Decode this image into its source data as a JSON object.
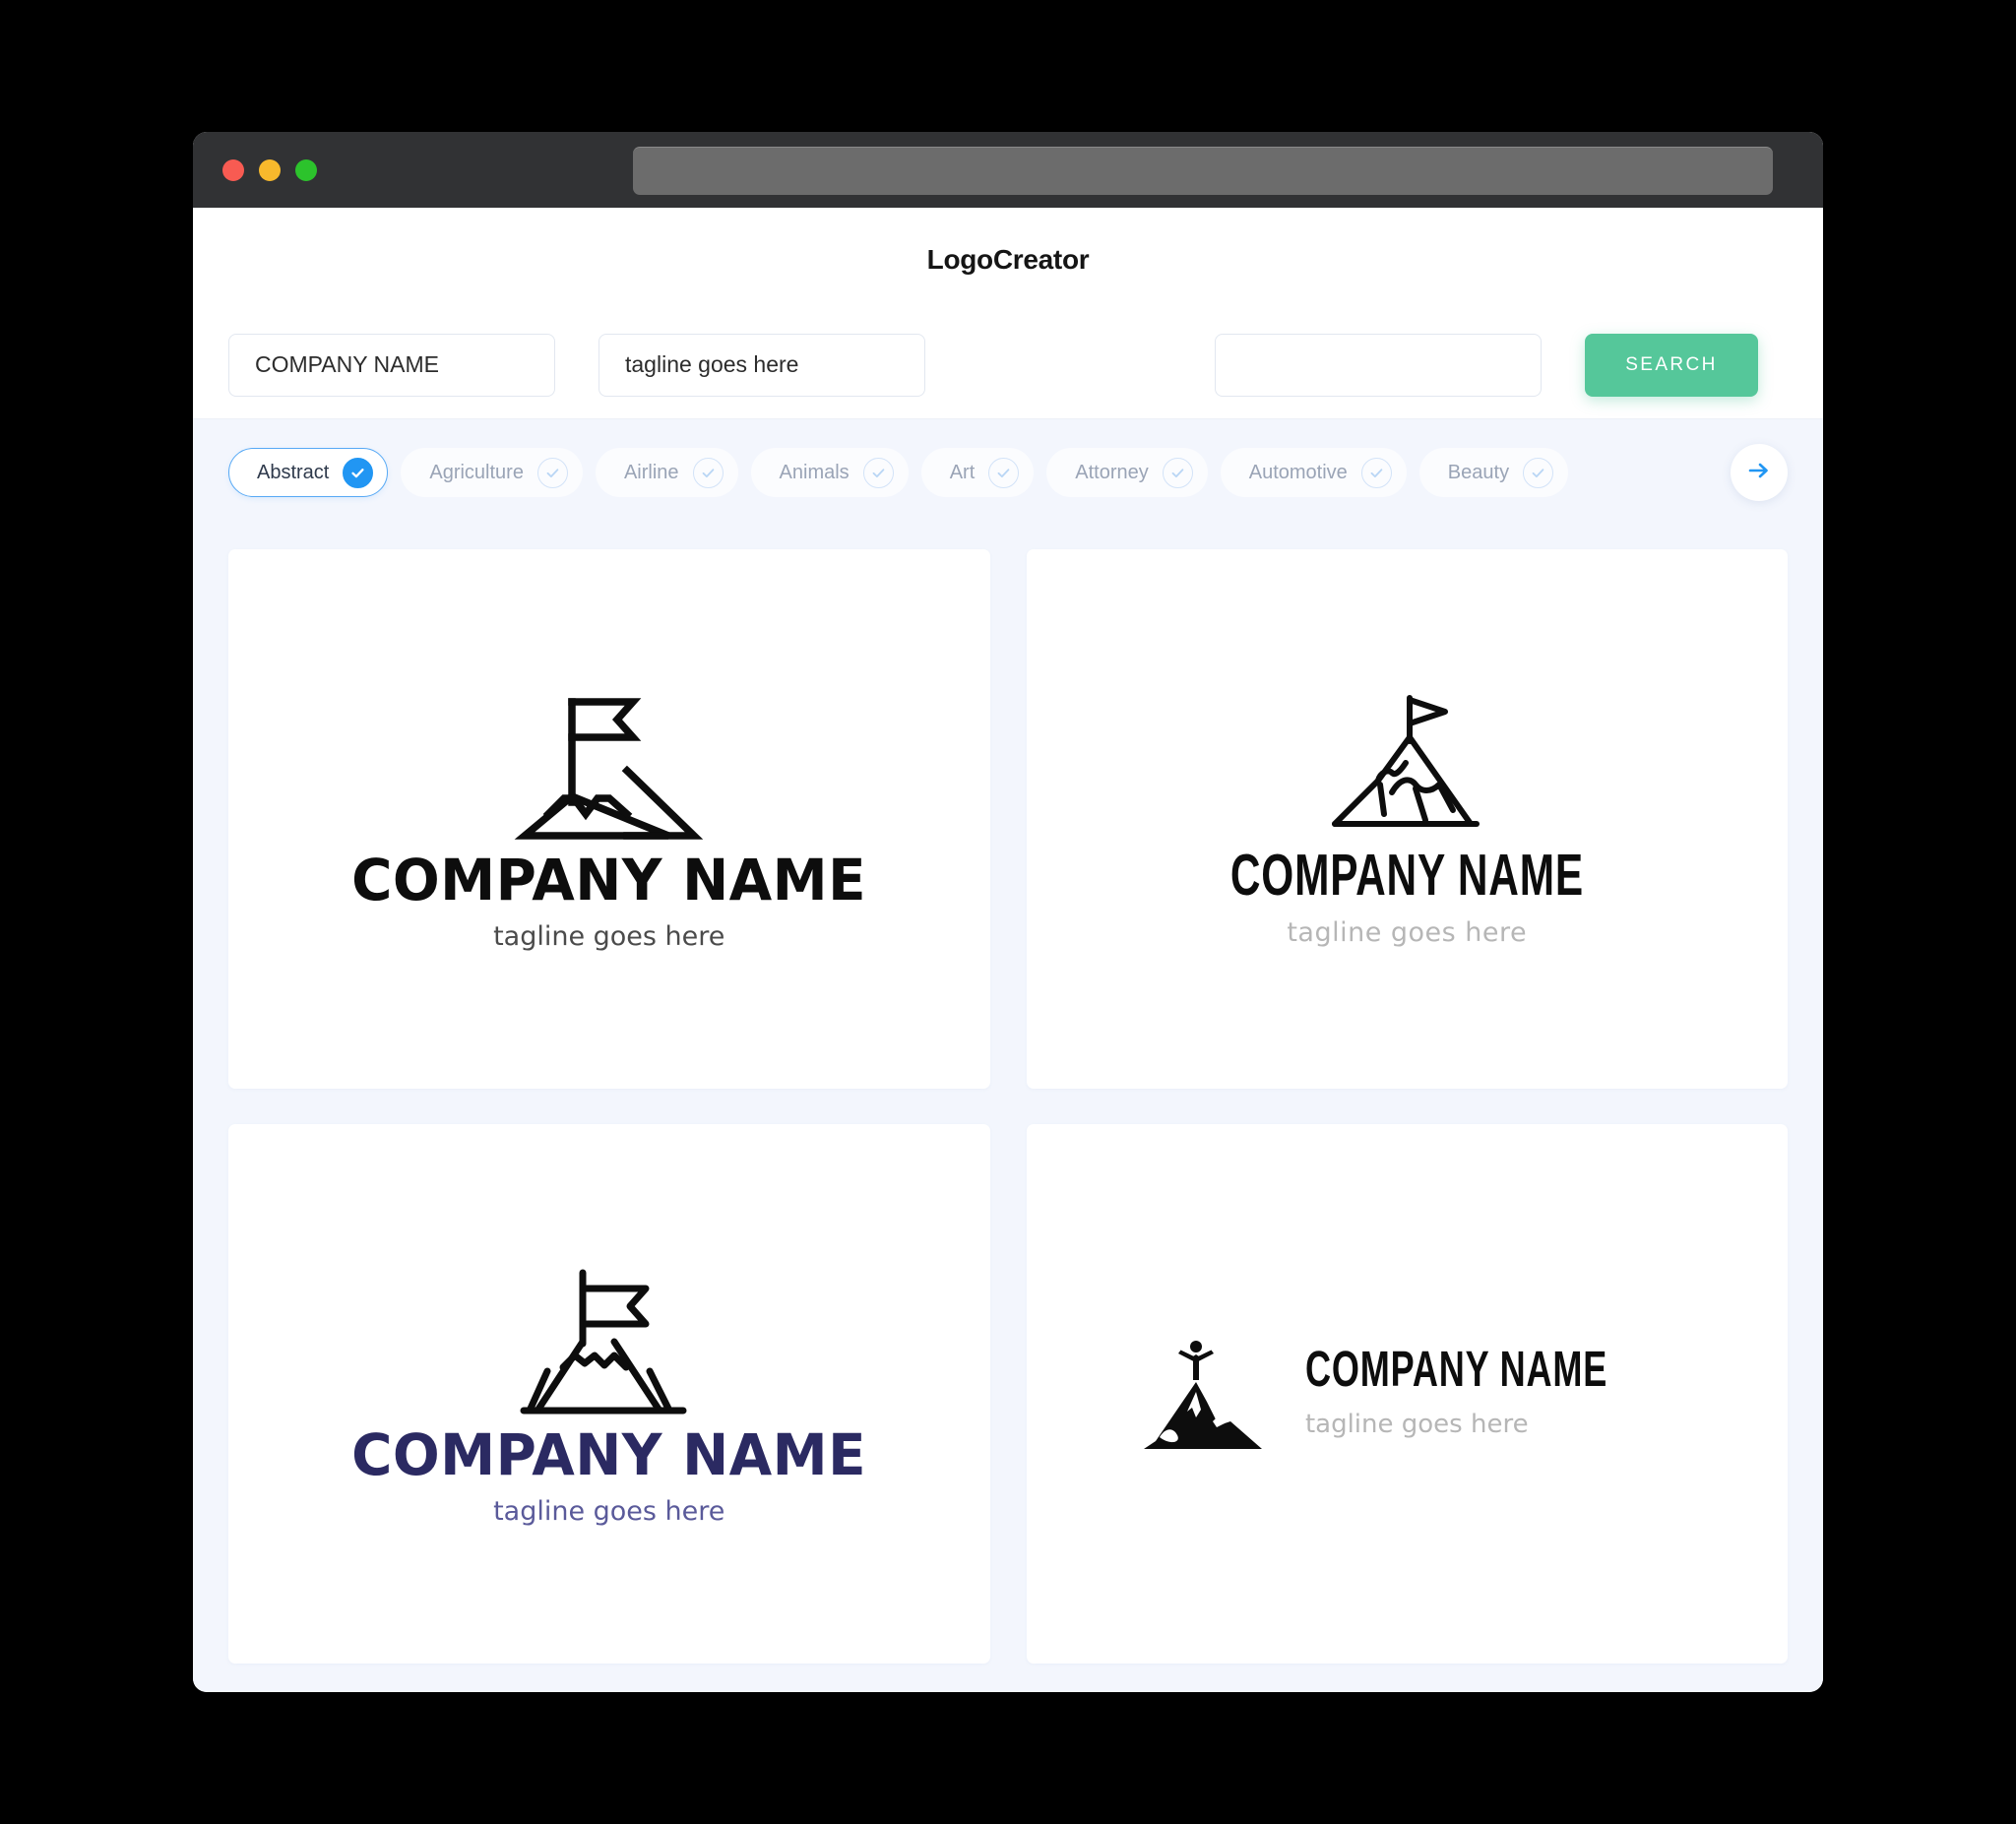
{
  "window": {
    "traffic_lights": [
      {
        "name": "close",
        "color": "#f85b52"
      },
      {
        "name": "minimize",
        "color": "#f8b92c"
      },
      {
        "name": "maximize",
        "color": "#2cc32c"
      }
    ],
    "url_bar_value": ""
  },
  "header": {
    "title": "LogoCreator"
  },
  "search": {
    "company_value": "COMPANY NAME",
    "company_placeholder": "COMPANY NAME",
    "tagline_value": "tagline goes here",
    "tagline_placeholder": "tagline goes here",
    "extra_value": "",
    "extra_placeholder": "",
    "search_label": "SEARCH",
    "search_button_color": "#55c79a"
  },
  "categories": {
    "next_icon": "arrow-right-icon",
    "accent_selected": "#2196f3",
    "items": [
      {
        "label": "Abstract",
        "selected": true
      },
      {
        "label": "Agriculture",
        "selected": false
      },
      {
        "label": "Airline",
        "selected": false
      },
      {
        "label": "Animals",
        "selected": false
      },
      {
        "label": "Art",
        "selected": false
      },
      {
        "label": "Attorney",
        "selected": false
      },
      {
        "label": "Automotive",
        "selected": false
      },
      {
        "label": "Beauty",
        "selected": false
      }
    ]
  },
  "results": [
    {
      "variant": "v1",
      "icon": "mountain-with-flag-outline-icon",
      "name": "COMPANY NAME",
      "tagline": "tagline goes here",
      "name_color": "#0d0d0d",
      "tagline_color": "#4b4b4b",
      "layout": "stacked"
    },
    {
      "variant": "v2",
      "icon": "mountain-peak-pennant-flag-outline-icon",
      "name": "COMPANY NAME",
      "tagline": "tagline goes here",
      "name_color": "#0d0d0d",
      "tagline_color": "#b6b6b6",
      "layout": "stacked"
    },
    {
      "variant": "v3",
      "icon": "mountain-with-pole-flag-outline-icon",
      "name": "COMPANY NAME",
      "tagline": "tagline goes here",
      "name_color": "#2b2a62",
      "tagline_color": "#5a5a9a",
      "layout": "stacked"
    },
    {
      "variant": "v4",
      "icon": "mountain-summit-climber-solid-icon",
      "name": "COMPANY NAME",
      "tagline": "tagline goes here",
      "name_color": "#0d0d0d",
      "tagline_color": "#b6b6b6",
      "layout": "horizontal"
    }
  ]
}
